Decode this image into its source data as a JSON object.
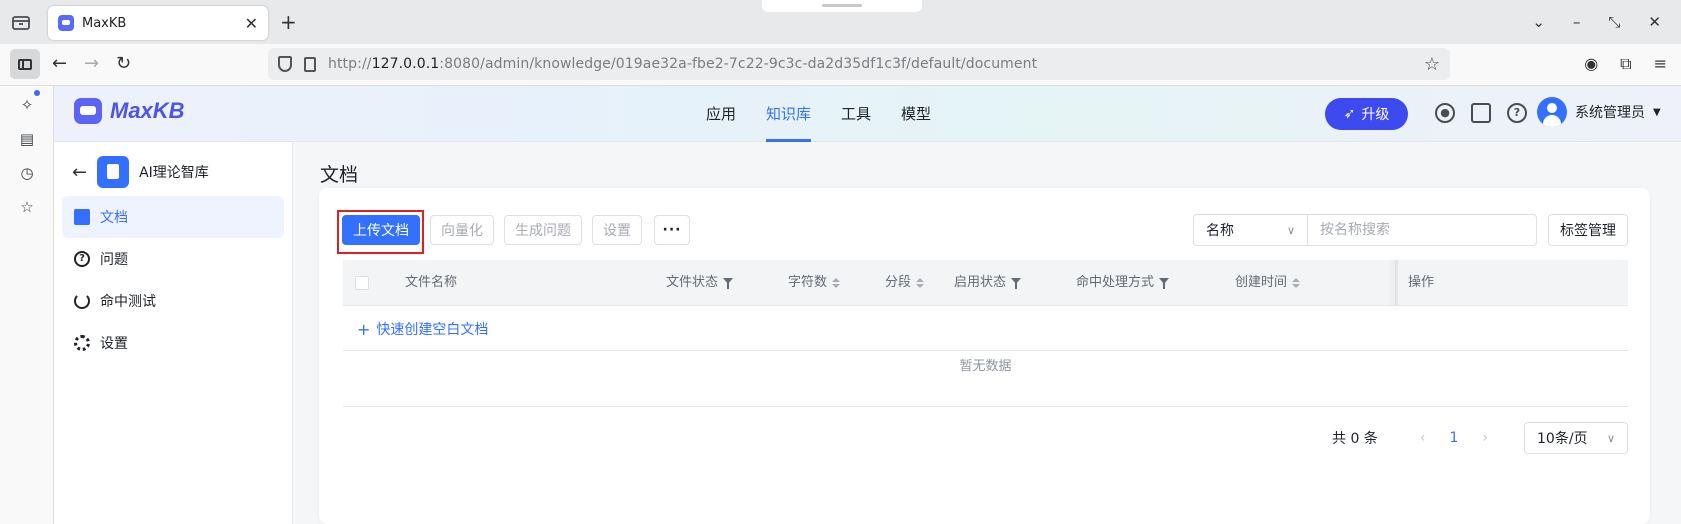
{
  "browser": {
    "tab": {
      "title": "MaxKB",
      "close": "✕"
    },
    "new_tab": "+",
    "url_host": "127.0.0.1",
    "url_prefix": "http://",
    "url_rest": ":8080/admin/knowledge/019ae32a-fbe2-7c22-9c3c-da2d35df1c3f/default/document"
  },
  "app": {
    "logo_text": "MaxKB",
    "nav": [
      {
        "label": "应用",
        "active": false
      },
      {
        "label": "知识库",
        "active": true
      },
      {
        "label": "工具",
        "active": false
      },
      {
        "label": "模型",
        "active": false
      }
    ],
    "upgrade_label": "升级",
    "user_name": "系统管理员",
    "accent": "#3370ff"
  },
  "sidebar": {
    "knowledge_name": "AI理论智库",
    "items": [
      {
        "label": "文档",
        "icon": "document-icon",
        "active": true
      },
      {
        "label": "问题",
        "icon": "question-icon",
        "active": false
      },
      {
        "label": "命中测试",
        "icon": "hit-test-icon",
        "active": false
      },
      {
        "label": "设置",
        "icon": "gear-icon",
        "active": false
      }
    ]
  },
  "main": {
    "title": "文档",
    "toolbar": {
      "upload": "上传文档",
      "vectorize": "向量化",
      "generate": "生成问题",
      "settings": "设置",
      "more": "···"
    },
    "search": {
      "field": "名称",
      "placeholder": "按名称搜索"
    },
    "tag_manage": "标签管理",
    "columns": [
      "文件名称",
      "文件状态",
      "字符数",
      "分段",
      "启用状态",
      "命中处理方式",
      "创建时间",
      "操作"
    ],
    "quick_create": "快速创建空白文档",
    "empty_text": "暂无数据",
    "pagination": {
      "total": "共 0 条",
      "current": "1",
      "page_size": "10条/页"
    }
  }
}
